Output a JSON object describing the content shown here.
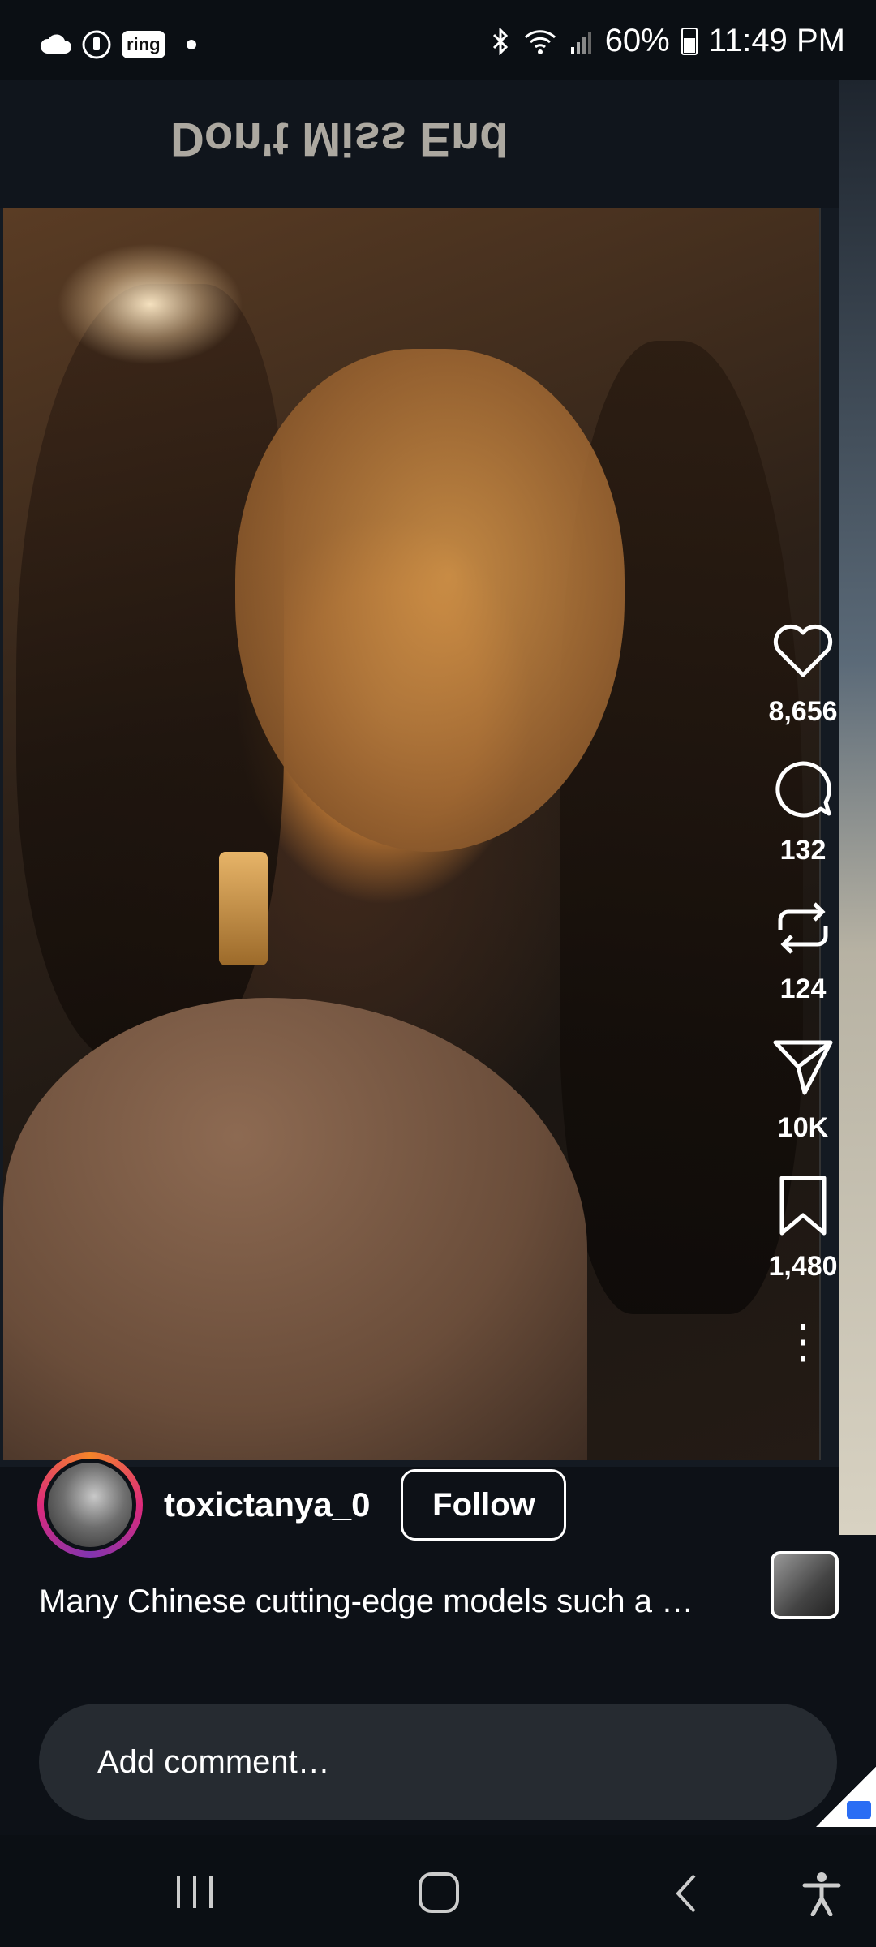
{
  "status_bar": {
    "left_icons": [
      "cloud-icon",
      "timer-icon",
      "ring-app-icon",
      "dot-icon"
    ],
    "ring_label": "ring",
    "battery": "60%",
    "time": "11:49 PM",
    "right_icons": [
      "bluetooth-icon",
      "wifi-icon",
      "signal-icon",
      "battery-icon"
    ]
  },
  "video": {
    "overlay_text": "Don't Miss End"
  },
  "actions": {
    "likes": "8,656",
    "comments": "132",
    "reposts": "124",
    "shares": "10K",
    "saves": "1,480"
  },
  "author": {
    "username": "toxictanya_0",
    "follow_label": "Follow"
  },
  "caption": "Many Chinese cutting-edge models such a …",
  "comment_bar": {
    "placeholder": "Add comment…"
  },
  "nav": {
    "items": [
      "recents-icon",
      "home-icon",
      "back-icon",
      "accessibility-icon"
    ]
  }
}
